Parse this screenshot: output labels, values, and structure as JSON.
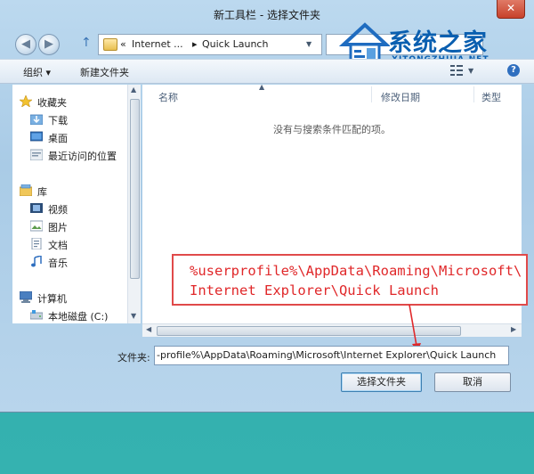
{
  "window": {
    "title": "新工具栏 - 选择文件夹",
    "close_glyph": "✕"
  },
  "nav": {
    "back_glyph": "◀",
    "forward_glyph": "▶",
    "up_glyph": "↑"
  },
  "address": {
    "overflow": "«",
    "crumb1": "Internet ...",
    "sep": "▸",
    "crumb2": "Quick Launch"
  },
  "watermark": {
    "title": "系统之家",
    "url": "XITONGZHIJIA.NET"
  },
  "toolbar": {
    "organize": "组织 ▾",
    "new_folder": "新建文件夹"
  },
  "sidebar": {
    "favorites": "收藏夹",
    "downloads": "下载",
    "desktop": "桌面",
    "recent": "最近访问的位置",
    "libraries": "库",
    "videos": "视频",
    "pictures": "图片",
    "documents": "文档",
    "music": "音乐",
    "computer": "计算机",
    "local_disk": "本地磁盘 (C:)"
  },
  "filelist": {
    "col_name": "名称",
    "col_modified": "修改日期",
    "col_type": "类型",
    "empty_message": "没有与搜索条件匹配的项。"
  },
  "annotation": {
    "line1": "%userprofile%\\AppData\\Roaming\\Microsoft\\",
    "line2": "Internet Explorer\\Quick Launch",
    "color": "#e0282a"
  },
  "folder_field": {
    "label": "文件夹:",
    "value": "-profile%\\AppData\\Roaming\\Microsoft\\Internet Explorer\\Quick Launch"
  },
  "buttons": {
    "select_folder": "选择文件夹",
    "cancel": "取消"
  }
}
